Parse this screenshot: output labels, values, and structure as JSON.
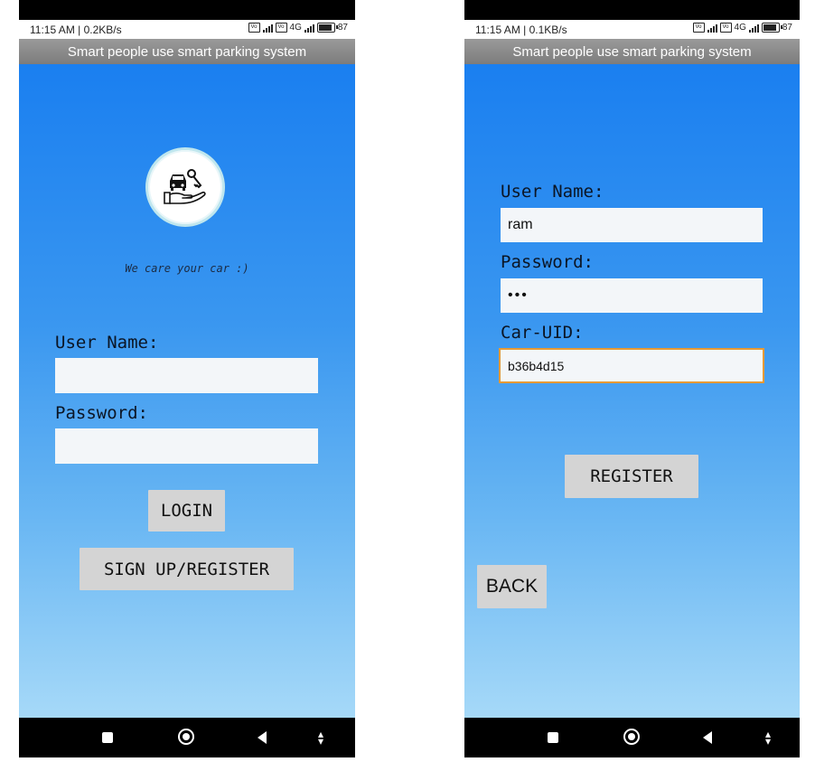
{
  "left": {
    "status": {
      "time": "11:15 AM | 0.2KB/s",
      "network": "4G",
      "battery": "87"
    },
    "title": "Smart people use  smart parking system",
    "tagline": "We care your car :)",
    "logo_icon": "car-key-hand-icon",
    "username_label": "User Name:",
    "username_value": "",
    "password_label": "Password:",
    "password_value": "",
    "login_label": "LOGIN",
    "signup_label": "SIGN UP/REGISTER"
  },
  "right": {
    "status": {
      "time": "11:15 AM | 0.1KB/s",
      "network": "4G",
      "battery": "87"
    },
    "title": "Smart people use  smart parking system",
    "username_label": "User Name:",
    "username_value": "ram",
    "password_label": "Password:",
    "password_value": "•••",
    "caruid_label": "Car-UID:",
    "caruid_value": "b36b4d15",
    "register_label": "REGISTER",
    "back_label": "BACK"
  },
  "colors": {
    "gradient_top": "#1a7ff0",
    "gradient_bottom": "#a6d9f8",
    "title_bar": "#8a8a8a",
    "button_bg": "#d4d4d4",
    "focus_border": "#e69a35"
  }
}
